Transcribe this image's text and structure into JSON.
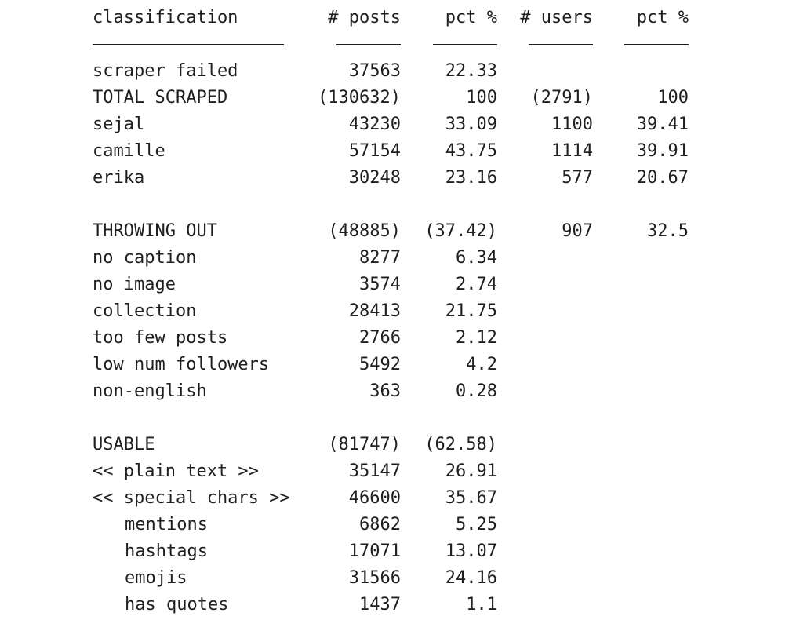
{
  "header": {
    "classification": "classification",
    "posts": "# posts",
    "posts_pct": "pct %",
    "users": "# users",
    "users_pct": "pct %"
  },
  "rows": [
    {
      "label": "scraper failed",
      "posts": "37563",
      "posts_pct": "22.33",
      "users": "",
      "users_pct": ""
    },
    {
      "label": "TOTAL SCRAPED",
      "posts": "(130632)",
      "posts_pct": "100",
      "users": "(2791)",
      "users_pct": "100"
    },
    {
      "label": "sejal",
      "posts": "43230",
      "posts_pct": "33.09",
      "users": "1100",
      "users_pct": "39.41"
    },
    {
      "label": "camille",
      "posts": "57154",
      "posts_pct": "43.75",
      "users": "1114",
      "users_pct": "39.91"
    },
    {
      "label": "erika",
      "posts": "30248",
      "posts_pct": "23.16",
      "users": "577",
      "users_pct": "20.67"
    },
    {
      "label": "THROWING OUT",
      "posts": "(48885)",
      "posts_pct": "(37.42)",
      "users": "907",
      "users_pct": "32.5"
    },
    {
      "label": "no caption",
      "posts": "8277",
      "posts_pct": "6.34",
      "users": "",
      "users_pct": ""
    },
    {
      "label": "no image",
      "posts": "3574",
      "posts_pct": "2.74",
      "users": "",
      "users_pct": ""
    },
    {
      "label": "collection",
      "posts": "28413",
      "posts_pct": "21.75",
      "users": "",
      "users_pct": ""
    },
    {
      "label": "too few posts",
      "posts": "2766",
      "posts_pct": "2.12",
      "users": "",
      "users_pct": ""
    },
    {
      "label": "low num followers",
      "posts": "5492",
      "posts_pct": "4.2",
      "users": "",
      "users_pct": ""
    },
    {
      "label": "non-english",
      "posts": "363",
      "posts_pct": "0.28",
      "users": "",
      "users_pct": ""
    },
    {
      "label": "USABLE",
      "posts": "(81747)",
      "posts_pct": "(62.58)",
      "users": "",
      "users_pct": ""
    },
    {
      "label": "<< plain text >>",
      "posts": "35147",
      "posts_pct": "26.91",
      "users": "",
      "users_pct": ""
    },
    {
      "label": "<< special chars >>",
      "posts": "46600",
      "posts_pct": "35.67",
      "users": "",
      "users_pct": ""
    },
    {
      "label": "mentions",
      "posts": "6862",
      "posts_pct": "5.25",
      "users": "",
      "users_pct": ""
    },
    {
      "label": "hashtags",
      "posts": "17071",
      "posts_pct": "13.07",
      "users": "",
      "users_pct": ""
    },
    {
      "label": "emojis",
      "posts": "31566",
      "posts_pct": "24.16",
      "users": "",
      "users_pct": ""
    },
    {
      "label": "has quotes",
      "posts": "1437",
      "posts_pct": "1.1",
      "users": "",
      "users_pct": ""
    }
  ]
}
